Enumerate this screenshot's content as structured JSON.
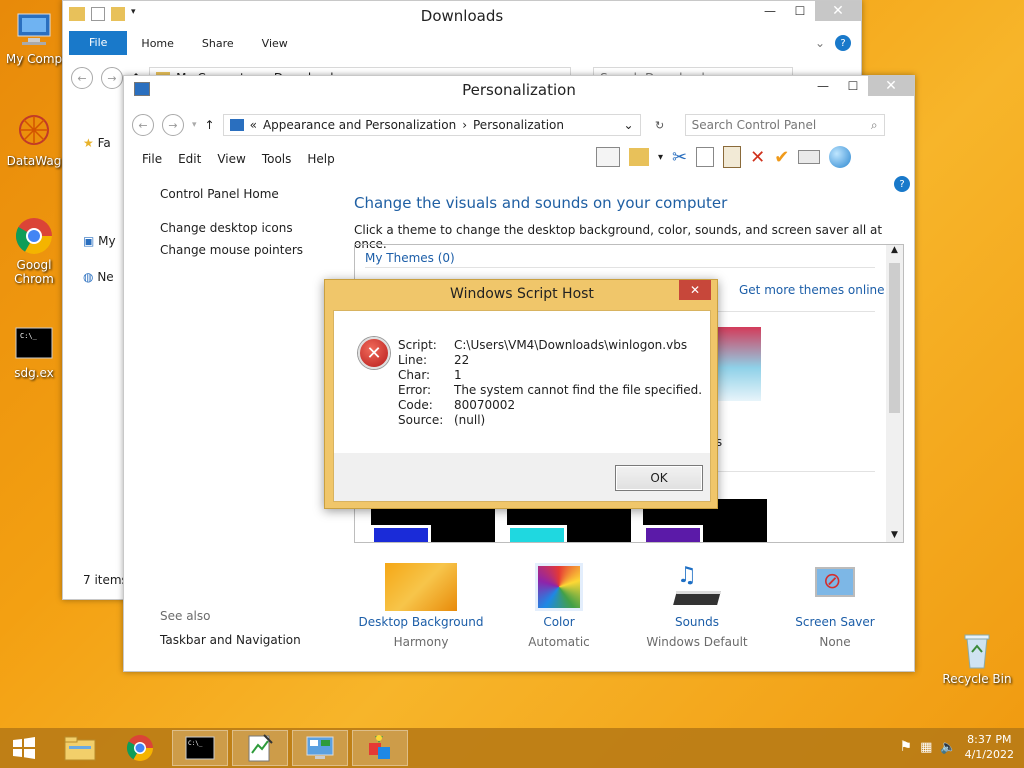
{
  "desktop": {
    "icons": [
      {
        "label": "My Comp",
        "icon": "computer-icon"
      },
      {
        "label": "DataWag",
        "icon": "datawag-icon"
      },
      {
        "label": "Googl Chrom",
        "icon": "chrome-icon"
      },
      {
        "label": "sdg.ex",
        "icon": "console-app-icon"
      },
      {
        "label": "Recycle Bin",
        "icon": "recycle-bin-icon"
      }
    ]
  },
  "explorer": {
    "title": "Downloads",
    "ribbon_tabs": [
      "File",
      "Home",
      "Share",
      "View"
    ],
    "address": [
      "My Computer",
      "Downloads"
    ],
    "search_placeholder": "Search Downloads",
    "nav_items": [
      "Fa",
      "My",
      "Ne"
    ],
    "status": "7 items"
  },
  "personalization": {
    "title": "Personalization",
    "breadcrumb": [
      "Appearance and Personalization",
      "Personalization"
    ],
    "search_placeholder": "Search Control Panel",
    "menu": [
      "File",
      "Edit",
      "View",
      "Tools",
      "Help"
    ],
    "left": {
      "home": "Control Panel Home",
      "links": [
        "Change desktop icons",
        "Change mouse pointers"
      ],
      "see_also": "See also",
      "see_also_links": [
        "Taskbar and Navigation"
      ]
    },
    "heading": "Change the visuals and sounds on your computer",
    "description": "Click a theme to change the desktop background, color, sounds, and screen saver all at once.",
    "my_themes": "My Themes (0)",
    "get_more": "Get more themes online",
    "partial_label": "rs",
    "bottom": [
      {
        "name": "Desktop Background",
        "sub": "Harmony",
        "icon": "desktop-background-icon"
      },
      {
        "name": "Color",
        "sub": "Automatic",
        "icon": "color-icon"
      },
      {
        "name": "Sounds",
        "sub": "Windows Default",
        "icon": "sounds-icon"
      },
      {
        "name": "Screen Saver",
        "sub": "None",
        "icon": "screen-saver-icon"
      }
    ]
  },
  "dialog": {
    "title": "Windows Script Host",
    "rows": [
      {
        "key": "Script:",
        "value": "C:\\Users\\VM4\\Downloads\\winlogon.vbs"
      },
      {
        "key": "Line:",
        "value": "22"
      },
      {
        "key": "Char:",
        "value": "1"
      },
      {
        "key": "Error:",
        "value": "The system cannot find the file specified."
      },
      {
        "key": "Code:",
        "value": "80070002"
      },
      {
        "key": "Source:",
        "value": "(null)"
      }
    ],
    "ok": "OK"
  },
  "taskbar": {
    "time": "8:37 PM",
    "date": "4/1/2022"
  }
}
